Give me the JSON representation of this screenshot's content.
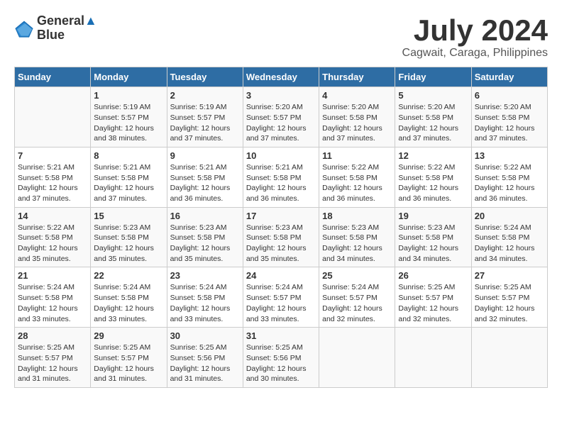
{
  "logo": {
    "line1": "General",
    "line2": "Blue"
  },
  "title": "July 2024",
  "subtitle": "Cagwait, Caraga, Philippines",
  "days_of_week": [
    "Sunday",
    "Monday",
    "Tuesday",
    "Wednesday",
    "Thursday",
    "Friday",
    "Saturday"
  ],
  "weeks": [
    [
      {
        "day": "",
        "info": ""
      },
      {
        "day": "1",
        "info": "Sunrise: 5:19 AM\nSunset: 5:57 PM\nDaylight: 12 hours\nand 38 minutes."
      },
      {
        "day": "2",
        "info": "Sunrise: 5:19 AM\nSunset: 5:57 PM\nDaylight: 12 hours\nand 37 minutes."
      },
      {
        "day": "3",
        "info": "Sunrise: 5:20 AM\nSunset: 5:57 PM\nDaylight: 12 hours\nand 37 minutes."
      },
      {
        "day": "4",
        "info": "Sunrise: 5:20 AM\nSunset: 5:58 PM\nDaylight: 12 hours\nand 37 minutes."
      },
      {
        "day": "5",
        "info": "Sunrise: 5:20 AM\nSunset: 5:58 PM\nDaylight: 12 hours\nand 37 minutes."
      },
      {
        "day": "6",
        "info": "Sunrise: 5:20 AM\nSunset: 5:58 PM\nDaylight: 12 hours\nand 37 minutes."
      }
    ],
    [
      {
        "day": "7",
        "info": "Sunrise: 5:21 AM\nSunset: 5:58 PM\nDaylight: 12 hours\nand 37 minutes."
      },
      {
        "day": "8",
        "info": "Sunrise: 5:21 AM\nSunset: 5:58 PM\nDaylight: 12 hours\nand 37 minutes."
      },
      {
        "day": "9",
        "info": "Sunrise: 5:21 AM\nSunset: 5:58 PM\nDaylight: 12 hours\nand 36 minutes."
      },
      {
        "day": "10",
        "info": "Sunrise: 5:21 AM\nSunset: 5:58 PM\nDaylight: 12 hours\nand 36 minutes."
      },
      {
        "day": "11",
        "info": "Sunrise: 5:22 AM\nSunset: 5:58 PM\nDaylight: 12 hours\nand 36 minutes."
      },
      {
        "day": "12",
        "info": "Sunrise: 5:22 AM\nSunset: 5:58 PM\nDaylight: 12 hours\nand 36 minutes."
      },
      {
        "day": "13",
        "info": "Sunrise: 5:22 AM\nSunset: 5:58 PM\nDaylight: 12 hours\nand 36 minutes."
      }
    ],
    [
      {
        "day": "14",
        "info": "Sunrise: 5:22 AM\nSunset: 5:58 PM\nDaylight: 12 hours\nand 35 minutes."
      },
      {
        "day": "15",
        "info": "Sunrise: 5:23 AM\nSunset: 5:58 PM\nDaylight: 12 hours\nand 35 minutes."
      },
      {
        "day": "16",
        "info": "Sunrise: 5:23 AM\nSunset: 5:58 PM\nDaylight: 12 hours\nand 35 minutes."
      },
      {
        "day": "17",
        "info": "Sunrise: 5:23 AM\nSunset: 5:58 PM\nDaylight: 12 hours\nand 35 minutes."
      },
      {
        "day": "18",
        "info": "Sunrise: 5:23 AM\nSunset: 5:58 PM\nDaylight: 12 hours\nand 34 minutes."
      },
      {
        "day": "19",
        "info": "Sunrise: 5:23 AM\nSunset: 5:58 PM\nDaylight: 12 hours\nand 34 minutes."
      },
      {
        "day": "20",
        "info": "Sunrise: 5:24 AM\nSunset: 5:58 PM\nDaylight: 12 hours\nand 34 minutes."
      }
    ],
    [
      {
        "day": "21",
        "info": "Sunrise: 5:24 AM\nSunset: 5:58 PM\nDaylight: 12 hours\nand 33 minutes."
      },
      {
        "day": "22",
        "info": "Sunrise: 5:24 AM\nSunset: 5:58 PM\nDaylight: 12 hours\nand 33 minutes."
      },
      {
        "day": "23",
        "info": "Sunrise: 5:24 AM\nSunset: 5:58 PM\nDaylight: 12 hours\nand 33 minutes."
      },
      {
        "day": "24",
        "info": "Sunrise: 5:24 AM\nSunset: 5:57 PM\nDaylight: 12 hours\nand 33 minutes."
      },
      {
        "day": "25",
        "info": "Sunrise: 5:24 AM\nSunset: 5:57 PM\nDaylight: 12 hours\nand 32 minutes."
      },
      {
        "day": "26",
        "info": "Sunrise: 5:25 AM\nSunset: 5:57 PM\nDaylight: 12 hours\nand 32 minutes."
      },
      {
        "day": "27",
        "info": "Sunrise: 5:25 AM\nSunset: 5:57 PM\nDaylight: 12 hours\nand 32 minutes."
      }
    ],
    [
      {
        "day": "28",
        "info": "Sunrise: 5:25 AM\nSunset: 5:57 PM\nDaylight: 12 hours\nand 31 minutes."
      },
      {
        "day": "29",
        "info": "Sunrise: 5:25 AM\nSunset: 5:57 PM\nDaylight: 12 hours\nand 31 minutes."
      },
      {
        "day": "30",
        "info": "Sunrise: 5:25 AM\nSunset: 5:56 PM\nDaylight: 12 hours\nand 31 minutes."
      },
      {
        "day": "31",
        "info": "Sunrise: 5:25 AM\nSunset: 5:56 PM\nDaylight: 12 hours\nand 30 minutes."
      },
      {
        "day": "",
        "info": ""
      },
      {
        "day": "",
        "info": ""
      },
      {
        "day": "",
        "info": ""
      }
    ]
  ]
}
